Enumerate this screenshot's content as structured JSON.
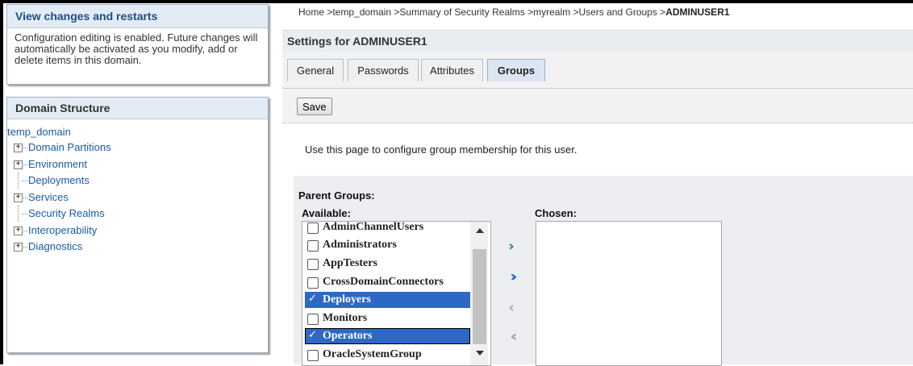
{
  "changes_panel": {
    "title": "View changes and restarts",
    "text": "Configuration editing is enabled. Future changes will automatically be activated as you modify, add or delete items in this domain."
  },
  "domain_structure": {
    "title": "Domain Structure",
    "root": "temp_domain",
    "items": [
      {
        "label": "Domain Partitions",
        "expandable": true
      },
      {
        "label": "Environment",
        "expandable": true
      },
      {
        "label": "Deployments",
        "expandable": false
      },
      {
        "label": "Services",
        "expandable": true
      },
      {
        "label": "Security Realms",
        "expandable": false
      },
      {
        "label": "Interoperability",
        "expandable": true
      },
      {
        "label": "Diagnostics",
        "expandable": true
      }
    ]
  },
  "breadcrumb": {
    "path": "Home >temp_domain >Summary of Security Realms >myrealm >Users and Groups >",
    "current": "ADMINUSER1"
  },
  "settings_title": "Settings for ADMINUSER1",
  "tabs": [
    {
      "label": "General",
      "active": false
    },
    {
      "label": "Passwords",
      "active": false
    },
    {
      "label": "Attributes",
      "active": false
    },
    {
      "label": "Groups",
      "active": true
    }
  ],
  "save_label": "Save",
  "description": "Use this page to configure group membership for this user.",
  "parent_groups_label": "Parent Groups:",
  "available_label": "Available:",
  "chosen_label": "Chosen:",
  "available_groups": [
    {
      "label": "AdminChannelUsers",
      "checked": false
    },
    {
      "label": "Administrators",
      "checked": false
    },
    {
      "label": "AppTesters",
      "checked": false
    },
    {
      "label": "CrossDomainConnectors",
      "checked": false
    },
    {
      "label": "Deployers",
      "checked": true
    },
    {
      "label": "Monitors",
      "checked": false
    },
    {
      "label": "Operators",
      "checked": true
    },
    {
      "label": "OracleSystemGroup",
      "checked": false
    }
  ],
  "chosen_groups": [],
  "icons": {
    "move_right": "chevron-right-icon",
    "move_all_right": "double-chevron-right-icon",
    "move_left": "chevron-left-icon",
    "move_all_left": "double-chevron-left-icon",
    "expand": "plus-box-icon",
    "check": "checkmark-icon"
  },
  "colors": {
    "selected_row": "#2e68c5",
    "link": "#1a5aa8",
    "arrow_active": "#2a6ec0",
    "arrow_disabled": "#aaaaaa"
  }
}
